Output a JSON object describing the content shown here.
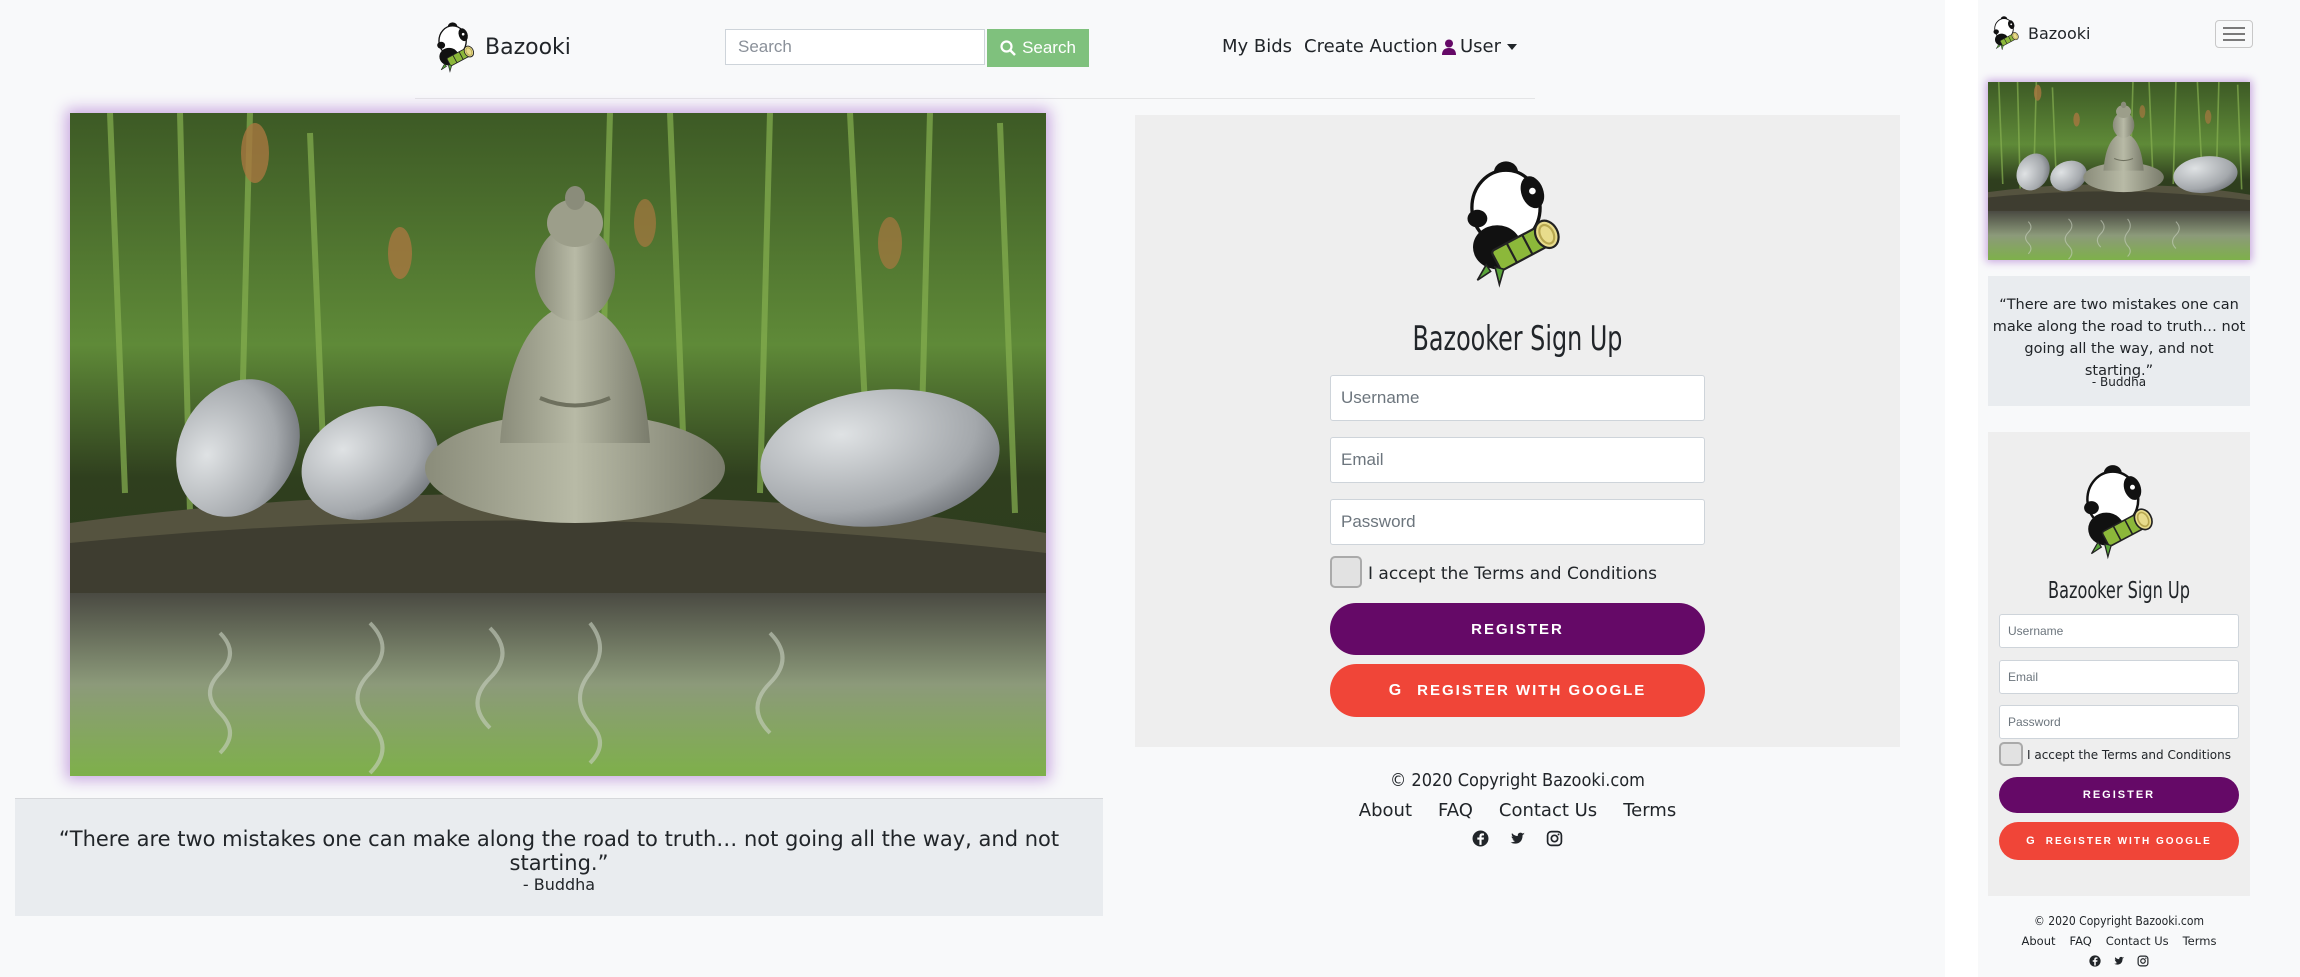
{
  "brand": {
    "name": "Bazooki"
  },
  "search": {
    "placeholder": "Search",
    "button_label": "Search"
  },
  "nav": {
    "my_bids": "My Bids",
    "create_auction": "Create Auction",
    "user_menu": "User"
  },
  "quote": {
    "text": "“There are two mistakes one can make along the road to truth… not going all the way, and not starting.”",
    "author": "- Buddha"
  },
  "signup": {
    "title": "Bazooker Sign Up",
    "username_placeholder": "Username",
    "email_placeholder": "Email",
    "password_placeholder": "Password",
    "terms_label": "I accept the Terms and Conditions",
    "register_label": "REGISTER",
    "google_label": "REGISTER WITH GOOGLE"
  },
  "footer": {
    "copyright": "© 2020 Copyright Bazooki.com",
    "links": [
      "About",
      "FAQ",
      "Contact Us",
      "Terms"
    ],
    "social_icons": [
      "facebook-icon",
      "twitter-icon",
      "instagram-icon"
    ]
  },
  "mobile_quote": {
    "line1": "“There are two mistakes one can",
    "line2": "make along the road to truth… not",
    "line3": "going all the way, and not starting.”"
  },
  "colors": {
    "register": "#650967",
    "google": "#f04538",
    "search_button": "#7fc17d",
    "user_icon": "#650967"
  }
}
